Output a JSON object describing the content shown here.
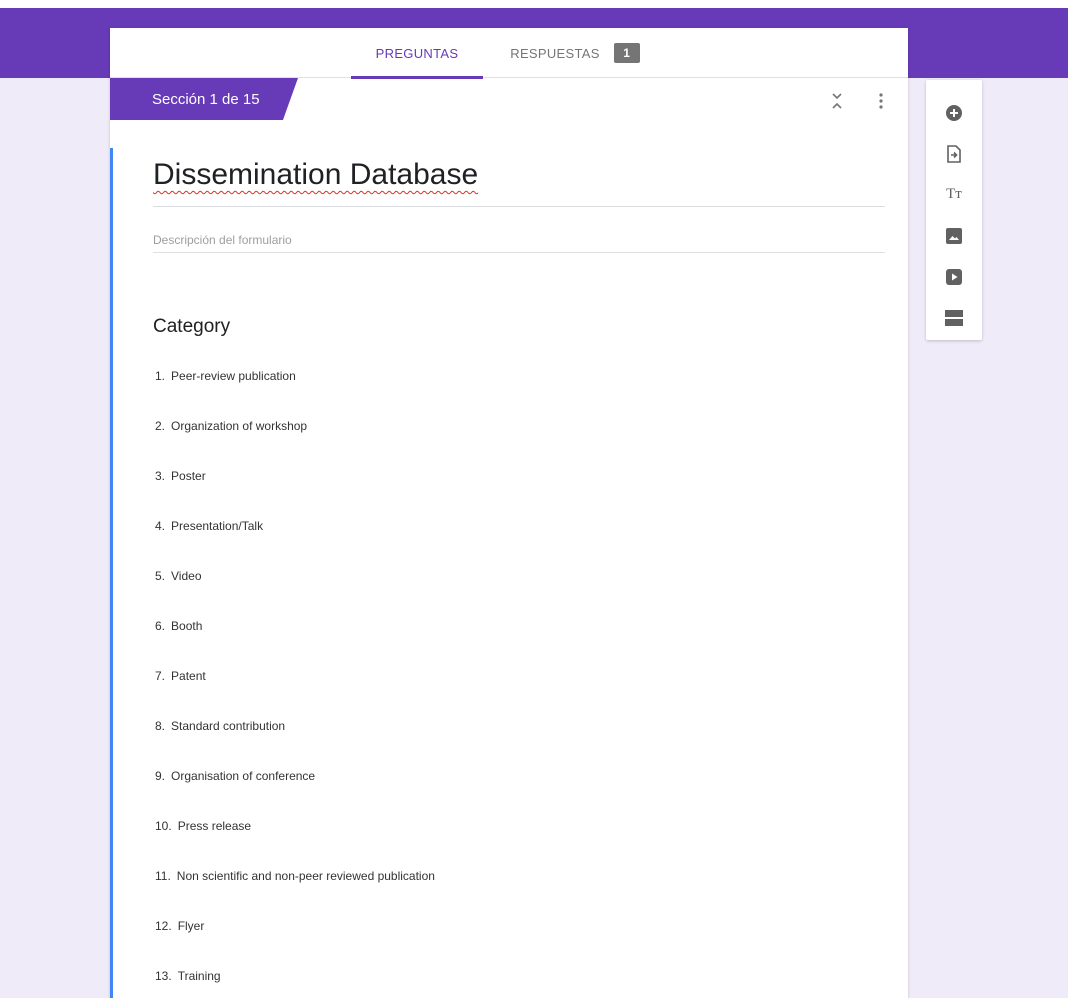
{
  "tabs": [
    {
      "label": "PREGUNTAS"
    },
    {
      "label": "RESPUESTAS",
      "badge": "1"
    }
  ],
  "section": {
    "label": "Sección 1 de 15"
  },
  "form": {
    "title": "Dissemination Database",
    "description_placeholder": "Descripción del formulario"
  },
  "question": {
    "title": "Category",
    "options": [
      {
        "num": "1.",
        "label": "Peer-review publication"
      },
      {
        "num": "2.",
        "label": "Organization of workshop"
      },
      {
        "num": "3.",
        "label": "Poster"
      },
      {
        "num": "4.",
        "label": "Presentation/Talk"
      },
      {
        "num": "5.",
        "label": "Video"
      },
      {
        "num": "6.",
        "label": "Booth"
      },
      {
        "num": "7.",
        "label": "Patent"
      },
      {
        "num": "8.",
        "label": "Standard contribution"
      },
      {
        "num": "9.",
        "label": "Organisation of conference"
      },
      {
        "num": "10.",
        "label": "Press release"
      },
      {
        "num": "11.",
        "label": "Non scientific and non-peer reviewed publication"
      },
      {
        "num": "12.",
        "label": "Flyer"
      },
      {
        "num": "13.",
        "label": "Training"
      }
    ]
  },
  "toolbar": {
    "items": [
      "add-question-icon",
      "import-questions-icon",
      "add-title-icon",
      "add-image-icon",
      "add-video-icon",
      "add-section-icon"
    ],
    "title_glyph": "Tт"
  },
  "colors": {
    "accent": "#673ab7",
    "background": "#f0ebf8",
    "focus": "#4285f4"
  }
}
